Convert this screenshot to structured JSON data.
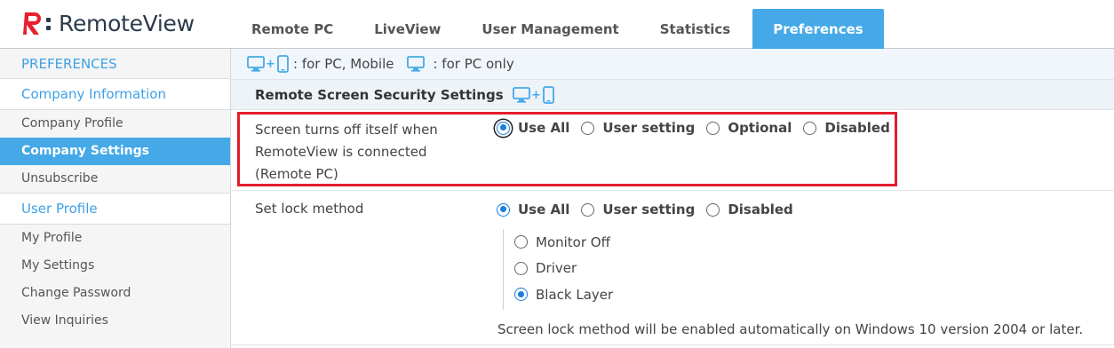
{
  "brand": {
    "name": "RemoteView",
    "accent": "#45a9e8",
    "logo_red": "#e8202e"
  },
  "tabs": [
    {
      "label": "Remote PC",
      "active": false
    },
    {
      "label": "LiveView",
      "active": false
    },
    {
      "label": "User Management",
      "active": false
    },
    {
      "label": "Statistics",
      "active": false
    },
    {
      "label": "Preferences",
      "active": true
    }
  ],
  "sidebar": {
    "header": "PREFERENCES",
    "groups": [
      {
        "title": "Company Information",
        "items": [
          "Company Profile",
          "Company Settings",
          "Unsubscribe"
        ],
        "active": "Company Settings"
      },
      {
        "title": "User Profile",
        "items": [
          "My Profile",
          "My Settings",
          "Change Password",
          "View Inquiries"
        ]
      }
    ]
  },
  "legend": {
    "pc_mobile": ": for PC, Mobile",
    "pc_only": ": for PC only",
    "icons": [
      "monitor-icon",
      "mobile-icon"
    ]
  },
  "section": {
    "title": "Remote Screen Security Settings",
    "icon": "monitor-mobile-icon"
  },
  "setting1": {
    "label_lines": [
      "Screen turns off itself when",
      "RemoteView is connected",
      "(Remote PC)"
    ],
    "options": [
      "Use All",
      "User setting",
      "Optional",
      "Disabled"
    ],
    "selected": "Use All",
    "highlight_color": "#e31d2b"
  },
  "setting2": {
    "label": "Set lock method",
    "options": [
      "Use All",
      "User setting",
      "Disabled"
    ],
    "selected": "Use All",
    "sub_options": [
      "Monitor Off",
      "Driver",
      "Black Layer"
    ],
    "sub_selected": "Black Layer",
    "note": "Screen lock method will be enabled automatically on Windows 10 version 2004 or later."
  }
}
